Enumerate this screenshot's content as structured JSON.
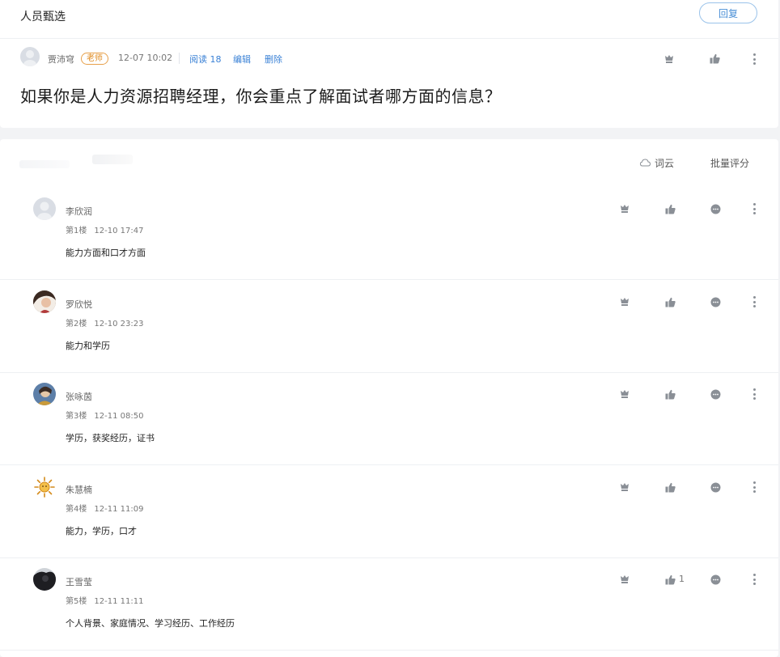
{
  "header": {
    "title": "人员甄选",
    "reply_label": "回复"
  },
  "post": {
    "author": "贾沛穹",
    "role_badge": "老师",
    "datetime": "12-07 10:02",
    "read_label": "阅读 18",
    "edit_label": "编辑",
    "delete_label": "删除",
    "question": "如果你是人力资源招聘经理，你会重点了解面试者哪方面的信息？"
  },
  "toolbar": {
    "wordcloud_label": "词云",
    "batch_grade_label": "批量评分"
  },
  "replies": [
    {
      "name": "李欣润",
      "floor": "第1楼",
      "datetime": "12-10 17:47",
      "content": "能力方面和口才方面",
      "likes": ""
    },
    {
      "name": "罗欣悦",
      "floor": "第2楼",
      "datetime": "12-10 23:23",
      "content": "能力和学历",
      "likes": ""
    },
    {
      "name": "张咏茵",
      "floor": "第3楼",
      "datetime": "12-11 08:50",
      "content": "学历，获奖经历，证书",
      "likes": ""
    },
    {
      "name": "朱慧楠",
      "floor": "第4楼",
      "datetime": "12-11 11:09",
      "content": "能力，学历，口才",
      "likes": ""
    },
    {
      "name": "王雪莹",
      "floor": "第5楼",
      "datetime": "12-11 11:11",
      "content": "个人背景、家庭情况、学习经历、工作经历",
      "likes": "1"
    }
  ],
  "colors": {
    "accent": "#3b82d6",
    "badge": "#e08a1e",
    "icon": "#8a8f96"
  }
}
